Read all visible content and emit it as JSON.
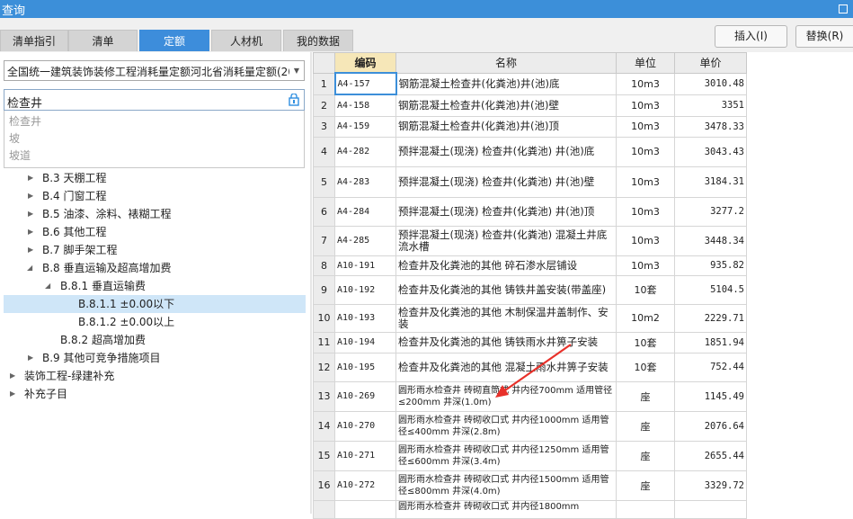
{
  "window": {
    "title": "查询"
  },
  "tabs": [
    {
      "label": "清单指引",
      "active": false
    },
    {
      "label": "清单",
      "active": false
    },
    {
      "label": "定额",
      "active": true
    },
    {
      "label": "人材机",
      "active": false
    },
    {
      "label": "我的数据",
      "active": false
    }
  ],
  "buttons": {
    "insert": "插入(I)",
    "replace": "替换(R)"
  },
  "left": {
    "quota_select": "全国统一建筑装饰装修工程消耗量定额河北省消耗量定额(20",
    "search_value": "检查井",
    "suggestions": [
      "检查井",
      "坡",
      "坡道"
    ],
    "tree": [
      {
        "label": "B.3 天棚工程",
        "level": 1,
        "expanded": false
      },
      {
        "label": "B.4 门窗工程",
        "level": 1,
        "expanded": false
      },
      {
        "label": "B.5 油漆、涂料、裱糊工程",
        "level": 1,
        "expanded": false
      },
      {
        "label": "B.6 其他工程",
        "level": 1,
        "expanded": false
      },
      {
        "label": "B.7 脚手架工程",
        "level": 1,
        "expanded": false
      },
      {
        "label": "B.8 垂直运输及超高增加费",
        "level": 1,
        "expanded": true
      },
      {
        "label": "B.8.1 垂直运输费",
        "level": 2,
        "expanded": true
      },
      {
        "label": "B.8.1.1 ±0.00以下",
        "level": 3,
        "selected": true
      },
      {
        "label": "B.8.1.2 ±0.00以上",
        "level": 3
      },
      {
        "label": "B.8.2 超高增加费",
        "level": 2
      },
      {
        "label": "B.9 其他可竞争措施项目",
        "level": 1,
        "expanded": false
      },
      {
        "label": "装饰工程-绿建补充",
        "level": 0,
        "expanded": false
      },
      {
        "label": "补充子目",
        "level": 0,
        "expanded": false
      }
    ]
  },
  "grid": {
    "headers": {
      "code": "编码",
      "name": "名称",
      "unit": "单位",
      "price": "单价"
    },
    "rows": [
      {
        "n": "1",
        "code": "A4-157",
        "name": "钢筋混凝土检查井(化粪池)井(池)底",
        "unit": "10m3",
        "price": "3010.48"
      },
      {
        "n": "2",
        "code": "A4-158",
        "name": "钢筋混凝土检查井(化粪池)井(池)壁",
        "unit": "10m3",
        "price": "3351"
      },
      {
        "n": "3",
        "code": "A4-159",
        "name": "钢筋混凝土检查井(化粪池)井(池)顶",
        "unit": "10m3",
        "price": "3478.33"
      },
      {
        "n": "4",
        "code": "A4-282",
        "name": "预拌混凝土(现浇) 检查井(化粪池) 井(池)底",
        "unit": "10m3",
        "price": "3043.43"
      },
      {
        "n": "5",
        "code": "A4-283",
        "name": "预拌混凝土(现浇) 检查井(化粪池) 井(池)壁",
        "unit": "10m3",
        "price": "3184.31"
      },
      {
        "n": "6",
        "code": "A4-284",
        "name": "预拌混凝土(现浇) 检查井(化粪池) 井(池)顶",
        "unit": "10m3",
        "price": "3277.2"
      },
      {
        "n": "7",
        "code": "A4-285",
        "name": "预拌混凝土(现浇) 检查井(化粪池) 混凝土井底流水槽",
        "unit": "10m3",
        "price": "3448.34"
      },
      {
        "n": "8",
        "code": "A10-191",
        "name": "检查井及化粪池的其他 碎石渗水层铺设",
        "unit": "10m3",
        "price": "935.82"
      },
      {
        "n": "9",
        "code": "A10-192",
        "name": "检查井及化粪池的其他 铸铁井盖安装(带盖座)",
        "unit": "10套",
        "price": "5104.5"
      },
      {
        "n": "10",
        "code": "A10-193",
        "name": "检查井及化粪池的其他 木制保温井盖制作、安装",
        "unit": "10m2",
        "price": "2229.71"
      },
      {
        "n": "11",
        "code": "A10-194",
        "name": "检查井及化粪池的其他 铸铁雨水井箅子安装",
        "unit": "10套",
        "price": "1851.94"
      },
      {
        "n": "12",
        "code": "A10-195",
        "name": "检查井及化粪池的其他 混凝土雨水井箅子安装",
        "unit": "10套",
        "price": "752.44"
      },
      {
        "n": "13",
        "code": "A10-269",
        "name": "圆形雨水检查井 砖砌直筒式 井内径700mm 适用管径≤200mm 井深(1.0m)",
        "unit": "座",
        "price": "1145.49"
      },
      {
        "n": "14",
        "code": "A10-270",
        "name": "圆形雨水检查井 砖砌收口式 井内径1000mm 适用管径≤400mm 井深(2.8m)",
        "unit": "座",
        "price": "2076.64"
      },
      {
        "n": "15",
        "code": "A10-271",
        "name": "圆形雨水检查井 砖砌收口式 井内径1250mm 适用管径≤600mm 井深(3.4m)",
        "unit": "座",
        "price": "2655.44"
      },
      {
        "n": "16",
        "code": "A10-272",
        "name": "圆形雨水检查井 砖砌收口式 井内径1500mm 适用管径≤800mm 井深(4.0m)",
        "unit": "座",
        "price": "3329.72"
      },
      {
        "n": "",
        "code": "",
        "name": "圆形雨水检查井 砖砌收口式 井内径1800mm",
        "unit": "",
        "price": ""
      }
    ]
  },
  "colors": {
    "titlebar": "#3c8fd9",
    "active_tab": "#3d8ddb",
    "selected_node": "#cfe6f8",
    "annotation_arrow": "#e8312a"
  }
}
